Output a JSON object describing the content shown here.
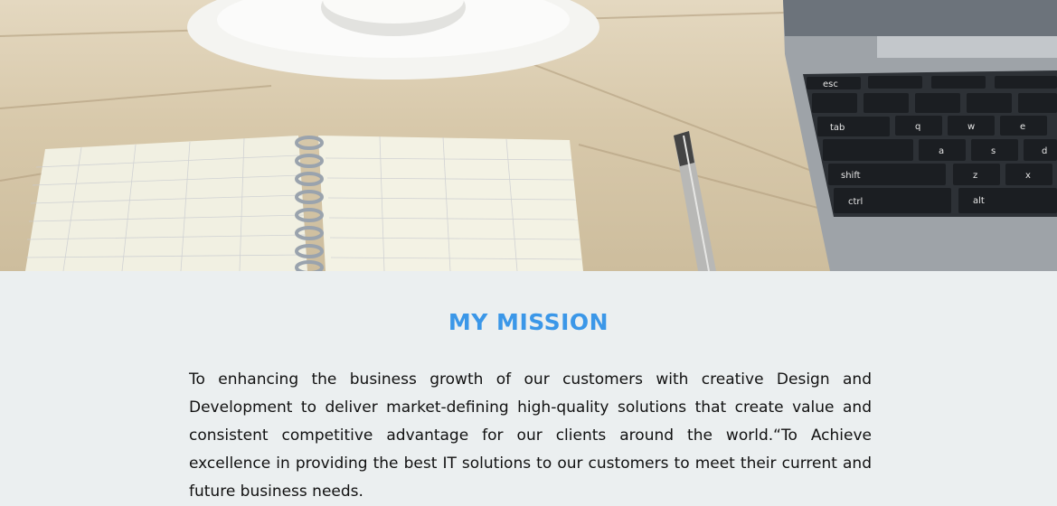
{
  "hero": {
    "image_alt": "Desk with coffee cup, notebook, pen and laptop",
    "keys": {
      "esc": "esc",
      "tab": "tab",
      "shift": "shift",
      "ctrl": "ctrl",
      "alt": "alt",
      "q": "q",
      "w": "w",
      "e": "e",
      "a": "a",
      "s": "s",
      "d": "d",
      "z": "z",
      "x": "x"
    }
  },
  "mission": {
    "title": "MY MISSION",
    "body": "To enhancing the business growth of our customers with creative Design and Development to deliver market-defining high-quality solutions that create value and consistent competitive advantage for our clients around the world.“To Achieve excellence in providing the best IT solutions to our customers to meet their current and future business needs."
  },
  "colors": {
    "title": "#3b97e8",
    "section_bg": "#ebeff0",
    "body_text": "#111111"
  }
}
